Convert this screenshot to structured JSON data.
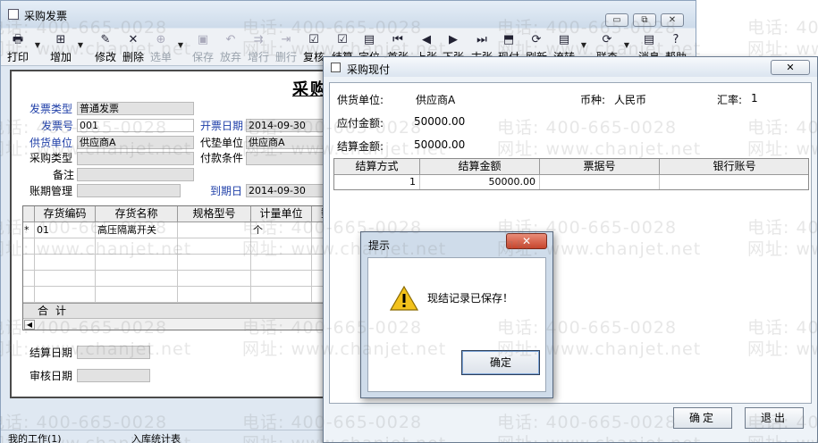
{
  "main_window": {
    "title": "采购发票",
    "controls": {
      "minimize": "▭",
      "restore": "⧉",
      "close": "✕"
    },
    "toolbar": [
      {
        "label": "打印",
        "icon": "print-icon",
        "glyph": "🖶",
        "enabled": true,
        "dropdown": true
      },
      {
        "label": "增加",
        "icon": "add-icon",
        "glyph": "⊞",
        "enabled": true,
        "dropdown": true
      },
      {
        "label": "修改",
        "icon": "edit-icon",
        "glyph": "✎",
        "enabled": true,
        "dropdown": false
      },
      {
        "label": "删除",
        "icon": "delete-icon",
        "glyph": "✕",
        "enabled": true,
        "dropdown": false
      },
      {
        "label": "选单",
        "icon": "select-icon",
        "glyph": "⊕",
        "enabled": false,
        "dropdown": true
      },
      {
        "label": "保存",
        "icon": "save-icon",
        "glyph": "▣",
        "enabled": false,
        "dropdown": false
      },
      {
        "label": "放弃",
        "icon": "discard-icon",
        "glyph": "↶",
        "enabled": false,
        "dropdown": false
      },
      {
        "label": "增行",
        "icon": "add-row-icon",
        "glyph": "⇉",
        "enabled": false,
        "dropdown": false
      },
      {
        "label": "删行",
        "icon": "delete-row-icon",
        "glyph": "⇥",
        "enabled": false,
        "dropdown": false
      },
      {
        "label": "复核",
        "icon": "review-icon",
        "glyph": "☑",
        "enabled": true,
        "dropdown": false
      },
      {
        "label": "结算",
        "icon": "settle-icon",
        "glyph": "☑",
        "enabled": true,
        "dropdown": false
      },
      {
        "label": "定位",
        "icon": "locate-icon",
        "glyph": "▤",
        "enabled": true,
        "dropdown": false
      },
      {
        "label": "首张",
        "icon": "first-icon",
        "glyph": "⏮",
        "enabled": true,
        "dropdown": false
      },
      {
        "label": "上张",
        "icon": "prev-icon",
        "glyph": "◀",
        "enabled": true,
        "dropdown": false
      },
      {
        "label": "下张",
        "icon": "next-icon",
        "glyph": "▶",
        "enabled": true,
        "dropdown": false
      },
      {
        "label": "末张",
        "icon": "last-icon",
        "glyph": "⏭",
        "enabled": true,
        "dropdown": false
      },
      {
        "label": "现付",
        "icon": "cash-pay-icon",
        "glyph": "⬒",
        "enabled": true,
        "dropdown": false
      },
      {
        "label": "刷新",
        "icon": "refresh-icon",
        "glyph": "⟳",
        "enabled": true,
        "dropdown": false
      },
      {
        "label": "流转",
        "icon": "flow-icon",
        "glyph": "▤",
        "enabled": true,
        "dropdown": true
      },
      {
        "label": "联查",
        "icon": "query-icon",
        "glyph": "⟳",
        "enabled": true,
        "dropdown": true
      },
      {
        "label": "消息",
        "icon": "message-icon",
        "glyph": "▤",
        "enabled": true,
        "dropdown": false
      },
      {
        "label": "帮助",
        "icon": "help-icon",
        "glyph": "?",
        "enabled": true,
        "dropdown": false
      }
    ],
    "doc_title": "采购",
    "fields": {
      "invoice_type_label": "发票类型",
      "invoice_type_value": "普通发票",
      "invoice_no_label": "发票号",
      "invoice_no_value": "001",
      "invoice_date_label": "开票日期",
      "invoice_date_value": "2014-09-30",
      "supplier_label": "供货单位",
      "supplier_value": "供应商A",
      "agent_label": "代垫单位",
      "agent_value": "供应商A",
      "purchase_type_label": "采购类型",
      "purchase_type_value": "",
      "payment_terms_label": "付款条件",
      "payment_terms_value": "",
      "remark_label": "备注",
      "remark_value": "",
      "period_label": "账期管理",
      "period_value": "",
      "due_date_label": "到期日",
      "due_date_value": "2014-09-30",
      "settle_date_label": "结算日期",
      "settle_date_value": "",
      "audit_date_label": "审核日期",
      "audit_date_value": ""
    },
    "grid": {
      "columns": [
        "",
        "存货编码",
        "存货名称",
        "规格型号",
        "计量单位",
        "数"
      ],
      "rows": [
        {
          "marker": "*",
          "code": "01",
          "name": "高压隔离开关",
          "spec": "",
          "unit": "个"
        }
      ],
      "total_label": "合计"
    },
    "status_items": [
      "我的工作(1)",
      "入库统计表"
    ]
  },
  "dialog": {
    "title": "采购现付",
    "close_label": "✕",
    "supplier_label": "供货单位:",
    "supplier_value": "供应商A",
    "currency_label": "币种:",
    "currency_value": "人民币",
    "rate_label": "汇率:",
    "rate_value": "1",
    "payable_label": "应付金额:",
    "payable_value": "50000.00",
    "settle_amount_label": "结算金额:",
    "settle_amount_value": "50000.00",
    "columns": [
      "结算方式",
      "结算金额",
      "票据号",
      "银行账号"
    ],
    "rows": [
      {
        "method": "1",
        "amount": "50000.00",
        "bill_no": "",
        "account": ""
      }
    ],
    "ok_label": "确定",
    "exit_label": "退出"
  },
  "message_box": {
    "title": "提示",
    "close_label": "✕",
    "text": "现结记录已保存！",
    "ok_label": "确定"
  },
  "watermark": {
    "phone": "电话: 400-665-0028",
    "site": "网址: www.chanjet.net"
  }
}
